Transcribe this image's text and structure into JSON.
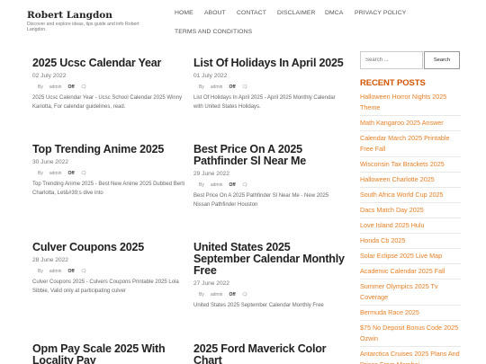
{
  "site": {
    "title": "Robert Langdon",
    "description": "Discover and explore ideas, tips guide and info Robert Langdon."
  },
  "nav": [
    {
      "label": "HOME"
    },
    {
      "label": "ABOUT"
    },
    {
      "label": "CONTACT"
    },
    {
      "label": "DISCLAIMER"
    },
    {
      "label": "DMCA"
    },
    {
      "label": "PRIVACY POLICY"
    },
    {
      "label": "TERMS AND CONDITIONS"
    }
  ],
  "posts": [
    {
      "title": "2025 Ucsc Calendar Year",
      "date": "02 July 2022",
      "author": "admin",
      "comments": "Off",
      "excerpt": "2025 Ucsc Calendar Year - Ucsc School Calendar 2025 Winny Kariotta, For calendar guidelines, read."
    },
    {
      "title": "List Of Holidays In April 2025",
      "date": "01 July 2022",
      "author": "admin",
      "comments": "Off",
      "excerpt": "List Of Holidays In April 2025 - April 2025 Monthly Calendar with United States Holidays."
    },
    {
      "title": "Top Trending Anime 2025",
      "date": "30 June 2022",
      "author": "admin",
      "comments": "Off",
      "excerpt": "Top Trending Anime 2025 - Best New Anime 2025 Dubbed Berti Charlotta, Let&#39;s dive into"
    },
    {
      "title": "Best Price On A 2025 Pathfinder Sl Near Me",
      "date": "29 June 2022",
      "author": "admin",
      "comments": "Off",
      "excerpt": "Best Price On A 2025 Pathfinder Sl Near Me - New 2025 Nissan Pathfinder Houston"
    },
    {
      "title": "Culver Coupons 2025",
      "date": "28 June 2022",
      "author": "admin",
      "comments": "Off",
      "excerpt": "Culver Coupons 2025 - Culvers Coupons Printable 2025 Lola Sibbie, Valid only at participating culver"
    },
    {
      "title": "United States 2025 September Calendar Monthly Free",
      "date": "27 June 2022",
      "author": "admin",
      "comments": "Off",
      "excerpt": "United States 2025 September Calendar Monthly Free"
    },
    {
      "title": "Opm Pay Scale 2025 With Locality Pay",
      "date": "",
      "author": "",
      "comments": "",
      "excerpt": ""
    },
    {
      "title": "2025 Ford Maverick Color Chart",
      "date": "",
      "author": "",
      "comments": "",
      "excerpt": ""
    }
  ],
  "sidebar": {
    "search_placeholder": "Search ...",
    "search_button": "Search",
    "recent_title": "RECENT POSTS",
    "recent_posts": [
      "Halloween Horror Nights 2025 Theme",
      "Math Kangaroo 2025 Answer",
      "Calendar March 2025 Printable Free Fall",
      "Wisconsin Tax Brackets 2025",
      "Halloween Charlotte 2025",
      "South Africa World Cup 2025",
      "Dacs Match Day 2025",
      "Love Island 2025 Hulu",
      "Honda Cb 2025",
      "Solar Eclipse 2025 Live Map",
      "Academic Calendar 2025 Fall",
      "Summer Olympics 2025 Tv Coverage",
      "Bermuda Race 2025",
      "$75 No Deposit Bonus Code 2025 Ozwin",
      "Antarctica Cruises 2025 Plans And Prices From Mombai"
    ]
  },
  "colors": {
    "accent": "#e67e22",
    "heading": "#222222"
  }
}
